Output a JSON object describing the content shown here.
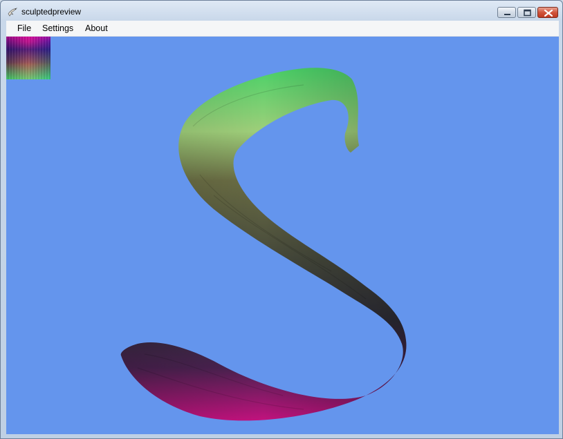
{
  "window": {
    "title": "sculptedpreview",
    "app_icon": "bird-app-icon",
    "controls": [
      "minimize-icon",
      "maximize-icon",
      "close-icon"
    ]
  },
  "menu": {
    "file": "File",
    "settings": "Settings",
    "about": "About"
  },
  "viewport": {
    "background": "#6495ed",
    "shape": "s-shaped-sculpted-mesh",
    "gradient_colors": [
      "#c2127e",
      "#3b2a4a",
      "#5a5a3a",
      "#9fcf7a",
      "#4ad168"
    ]
  }
}
